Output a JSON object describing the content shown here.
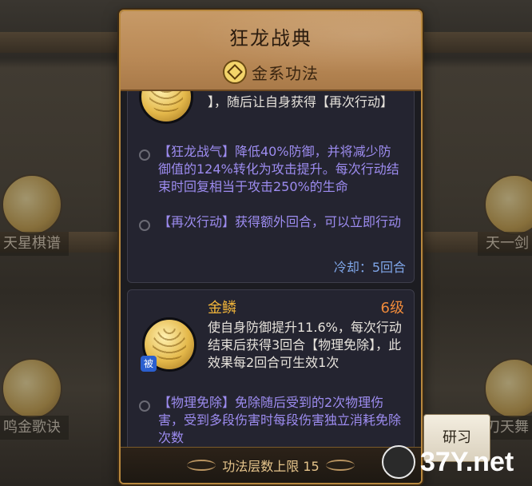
{
  "background": {
    "left_items": [
      {
        "label": "天星棋谱"
      },
      {
        "label": "鸣金歌诀"
      }
    ],
    "right_items": [
      {
        "label": "天一剑"
      },
      {
        "label": "刀天舞"
      }
    ]
  },
  "panel": {
    "title": "狂龙战典",
    "subtitle": "金系功法",
    "card1": {
      "top_text": "】，随后让自身获得【再次行动】",
      "effects": [
        "【狂龙战气】降低40%防御，并将减少防御值的124%转化为攻击提升。每次行动结束时回复相当于攻击250%的生命",
        "【再次行动】获得额外回合，可以立即行动"
      ],
      "cooldown": "冷却：5回合"
    },
    "card2": {
      "name": "金鳞",
      "level": "6级",
      "passive_badge": "被",
      "description": "使自身防御提升11.6%，每次行动结束后获得3回合【物理免除】，此效果每2回合可生效1次",
      "effect": "【物理免除】免除随后受到的2次物理伤害，受到多段伤害时每段伤害独立消耗免除次数"
    },
    "footer": "功法层数上限 15"
  },
  "research_button": "研习",
  "watermark": "37Y.net",
  "colors": {
    "accent_gold": "#b8883e",
    "purple_text": "#9d8cf0",
    "cooldown_blue": "#7fa6e8",
    "skill_name_orange": "#f0b43a"
  }
}
